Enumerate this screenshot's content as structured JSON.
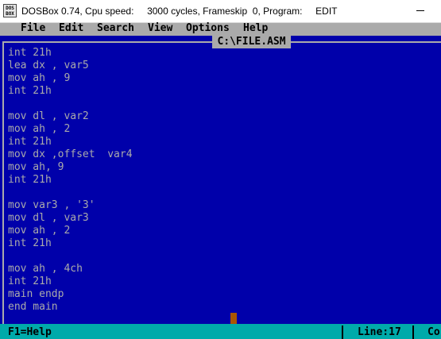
{
  "window": {
    "icon_label": "DOS BOX",
    "title": "DOSBox 0.74, Cpu speed:     3000 cycles, Frameskip  0, Program:     EDIT"
  },
  "menu": [
    "File",
    "Edit",
    "Search",
    "View",
    "Options",
    "Help"
  ],
  "editor": {
    "file_title": "C:\\FILE.ASM",
    "lines": [
      "int 21h",
      "lea dx , var5",
      "mov ah , 9",
      "int 21h",
      "",
      "mov dl , var2",
      "mov ah , 2",
      "int 21h",
      "mov dx ,offset  var4",
      "mov ah, 9",
      "int 21h",
      "",
      "mov var3 , '3'",
      "mov dl , var3",
      "mov ah , 2",
      "int 21h",
      "",
      "mov ah , 4ch",
      "int 21h",
      "main endp",
      "end main"
    ]
  },
  "status": {
    "help": "F1=Help",
    "line": "Line:17",
    "col": "Co"
  },
  "colors": {
    "editor_bg": "#0000aa",
    "text": "#aaaaaa",
    "menu_bg": "#aaaaaa",
    "status_bg": "#00aaaa",
    "cursor": "#aa5500"
  }
}
